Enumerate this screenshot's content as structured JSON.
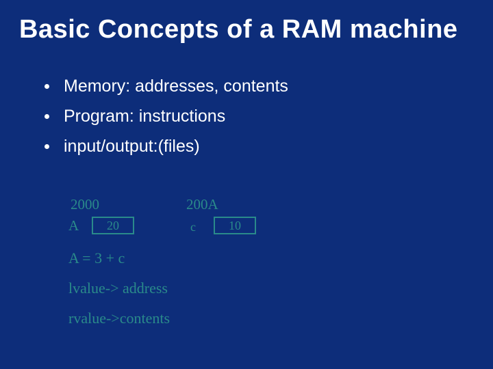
{
  "title": "Basic Concepts of a RAM machine",
  "bullets": [
    "Memory: addresses, contents",
    "Program: instructions",
    "input/output:(files)"
  ],
  "diagram": {
    "addr1": "2000",
    "addr2": "200A",
    "cell1_label": "A",
    "cell1_value": "20",
    "cell2_label": "c",
    "cell2_value": "10",
    "expr": "A = 3 + c",
    "lvalue": "lvalue-> address",
    "rvalue": "rvalue->contents"
  }
}
